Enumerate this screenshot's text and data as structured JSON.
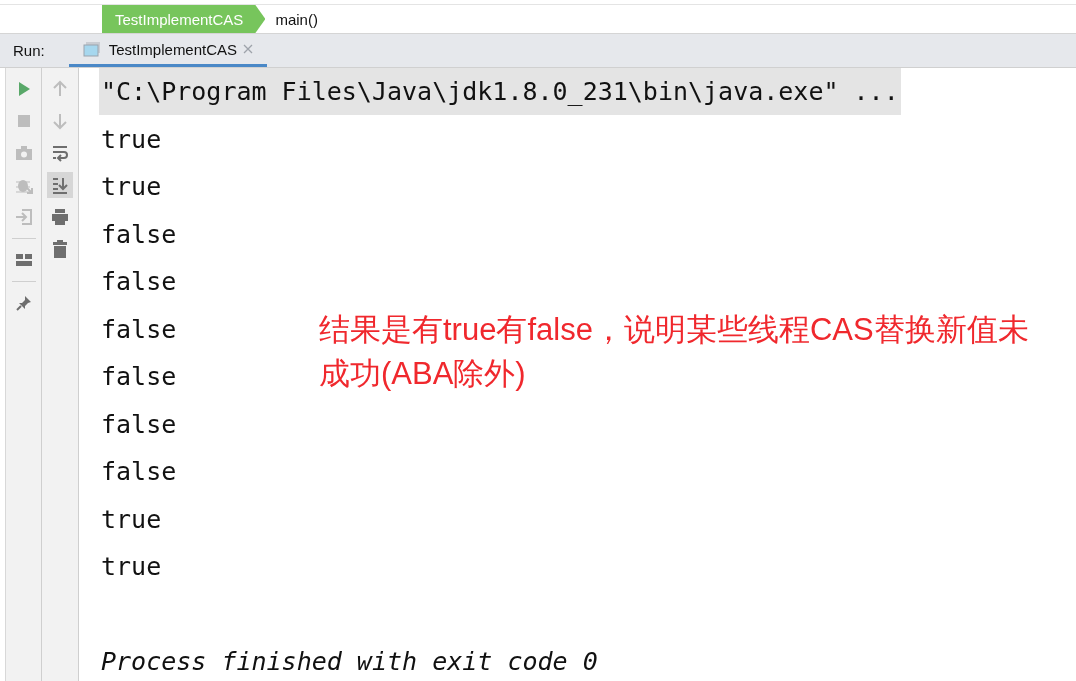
{
  "breadcrumb": [
    {
      "label": "TestImplementCAS",
      "kind": "class"
    },
    {
      "label": "main()",
      "kind": "method"
    }
  ],
  "run_panel": {
    "label": "Run:",
    "tab": {
      "label": "TestImplementCAS",
      "selected": true
    }
  },
  "run_toolbar": [
    {
      "kind": "run",
      "disabled": false
    },
    {
      "kind": "stop",
      "disabled": true
    },
    {
      "kind": "camera",
      "disabled": true
    },
    {
      "kind": "bug",
      "disabled": true
    },
    {
      "kind": "exit",
      "disabled": true
    },
    {
      "kind": "separator"
    },
    {
      "kind": "layout",
      "disabled": false
    },
    {
      "kind": "separator"
    },
    {
      "kind": "pin",
      "disabled": false
    }
  ],
  "console_toolbar": [
    {
      "kind": "up",
      "disabled": true,
      "on": false
    },
    {
      "kind": "down",
      "disabled": true,
      "on": false
    },
    {
      "kind": "wrap",
      "disabled": false,
      "on": false
    },
    {
      "kind": "scroll",
      "disabled": false,
      "on": true
    },
    {
      "kind": "print",
      "disabled": false,
      "on": false
    },
    {
      "kind": "trash",
      "disabled": false,
      "on": false
    }
  ],
  "console_lines": [
    {
      "text": "\"C:\\Program Files\\Java\\jdk1.8.0_231\\bin\\java.exe\" ...",
      "kind": "command"
    },
    {
      "text": "true",
      "kind": "output"
    },
    {
      "text": "true",
      "kind": "output"
    },
    {
      "text": "false",
      "kind": "output"
    },
    {
      "text": "false",
      "kind": "output"
    },
    {
      "text": "false",
      "kind": "output"
    },
    {
      "text": "false",
      "kind": "output"
    },
    {
      "text": "false",
      "kind": "output"
    },
    {
      "text": "false",
      "kind": "output"
    },
    {
      "text": "true",
      "kind": "output"
    },
    {
      "text": "true",
      "kind": "output"
    },
    {
      "kind": "blank"
    },
    {
      "text": "Process finished with exit code 0",
      "kind": "exit"
    }
  ],
  "annotation": "结果是有true有false，说明某些线程CAS替换新值未成功(ABA除外)"
}
